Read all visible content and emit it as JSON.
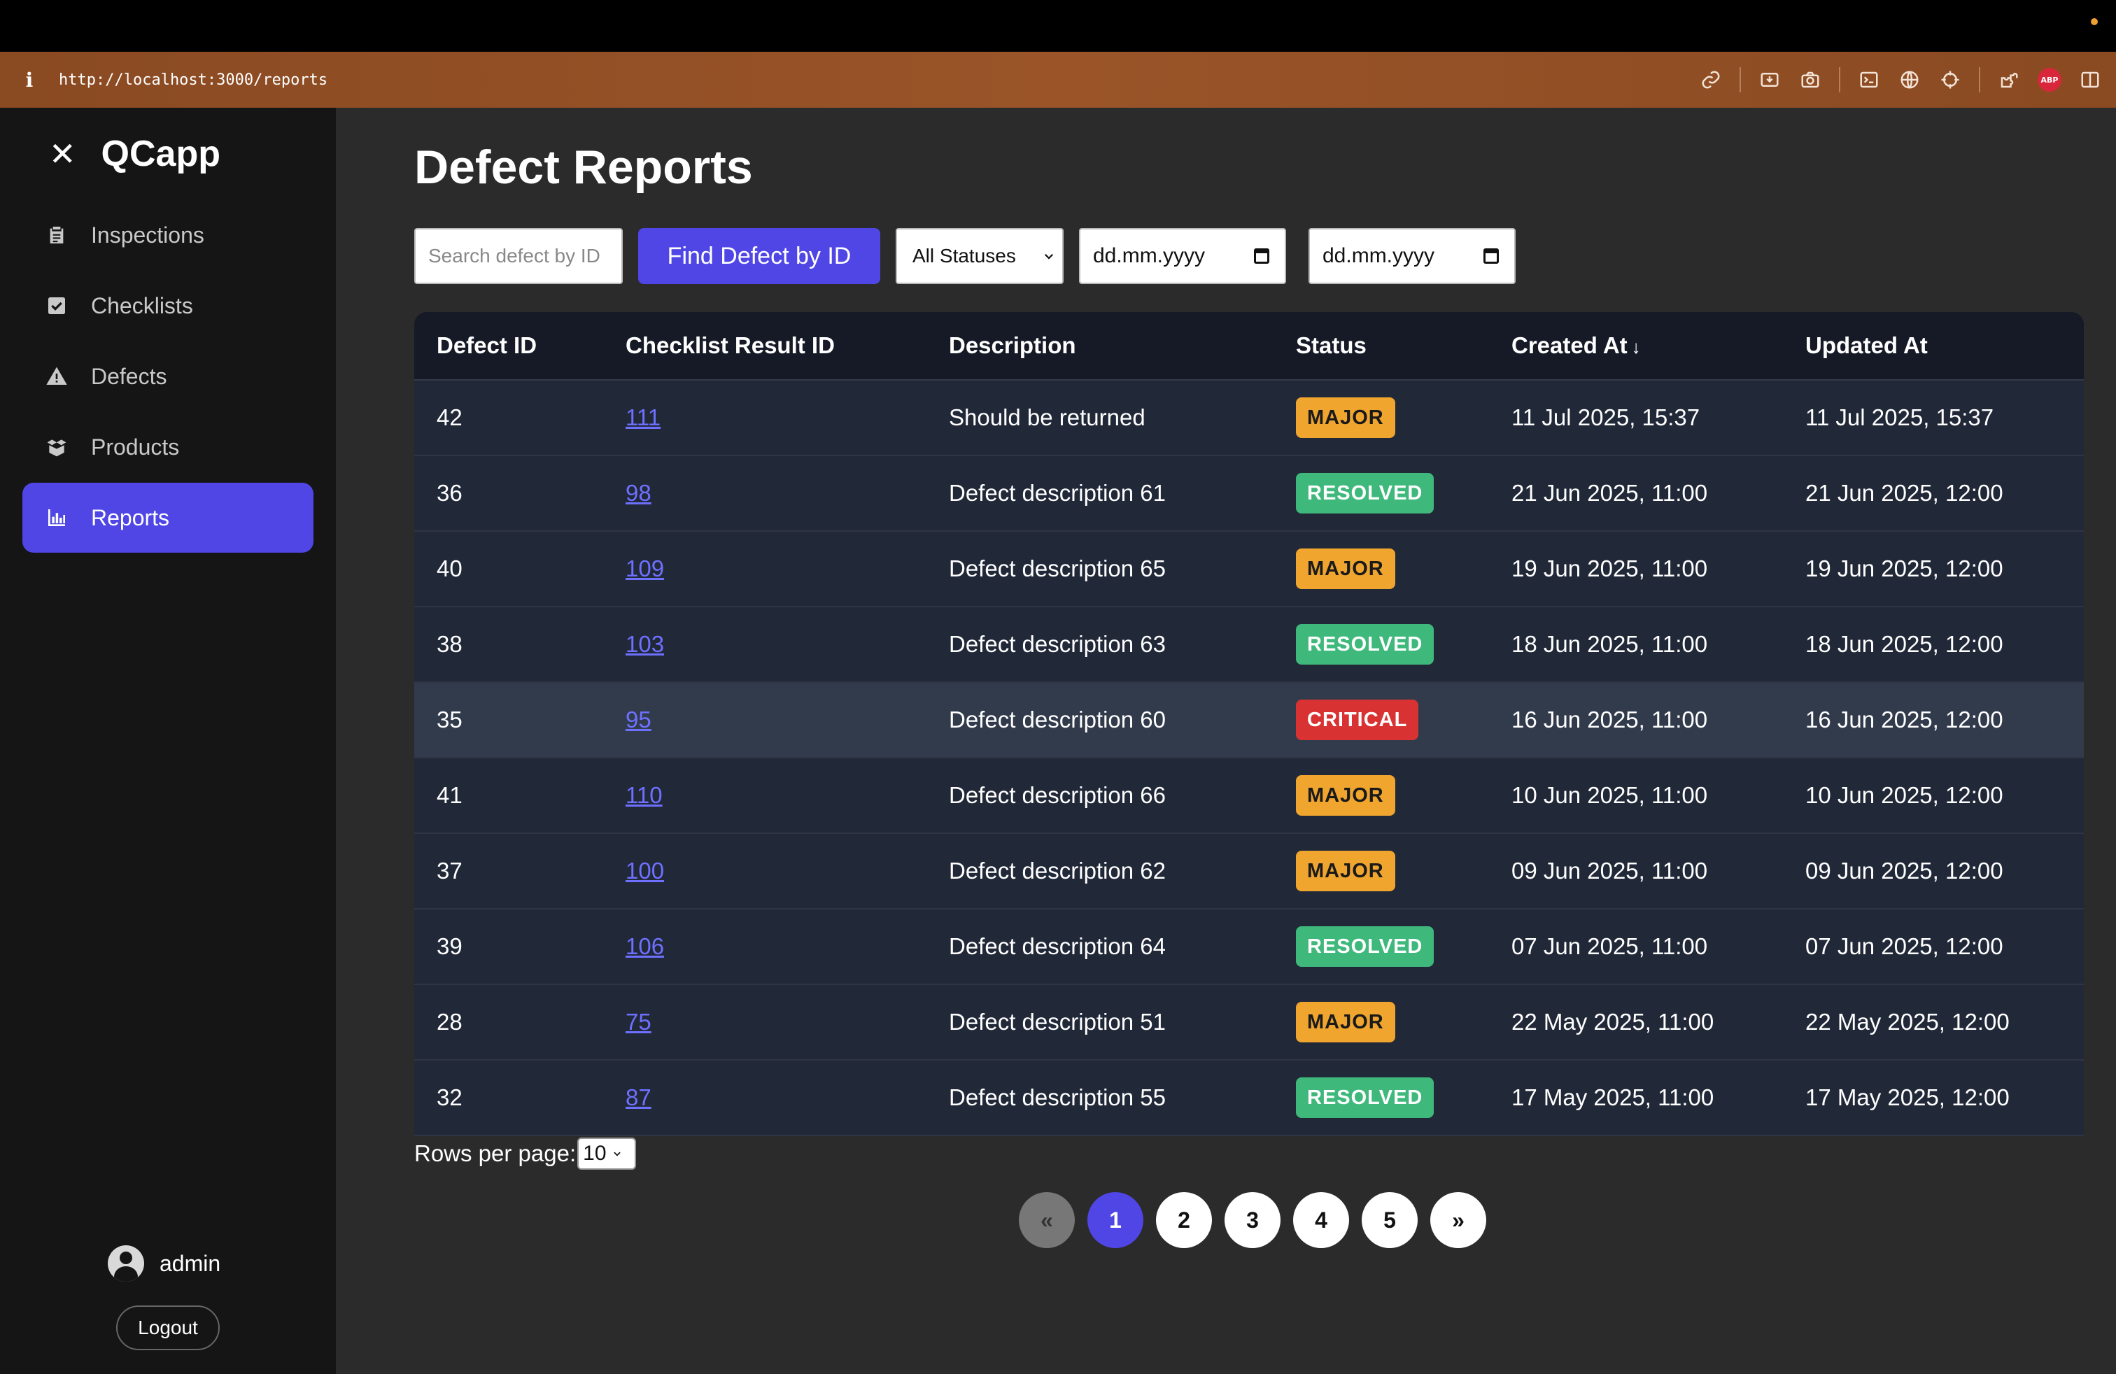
{
  "browser": {
    "url": "http://localhost:3000/reports",
    "info_label": "i",
    "abp_label": "ABP"
  },
  "sidebar": {
    "app_name": "QCapp",
    "close_glyph": "✕",
    "items": [
      {
        "label": "Inspections",
        "icon": "clipboard-icon"
      },
      {
        "label": "Checklists",
        "icon": "checkbox-icon"
      },
      {
        "label": "Defects",
        "icon": "warning-icon"
      },
      {
        "label": "Products",
        "icon": "box-icon"
      },
      {
        "label": "Reports",
        "icon": "bar-chart-icon",
        "active": true
      }
    ],
    "user_name": "admin",
    "logout_label": "Logout"
  },
  "main": {
    "title": "Defect Reports",
    "search_placeholder": "Search defect by ID",
    "find_button": "Find Defect by ID",
    "status_filter": "All Statuses",
    "date_from": "dd.mm.yyyy",
    "date_to": "dd.mm.yyyy",
    "columns": [
      "Defect ID",
      "Checklist Result ID",
      "Description",
      "Status",
      "Created At",
      "Updated At"
    ],
    "sort_indicator": "↓",
    "rows": [
      {
        "id": "42",
        "checklist": "111",
        "desc": "Should be returned",
        "status": "MAJOR",
        "created": "11 Jul 2025, 15:37",
        "updated": "11 Jul 2025, 15:37"
      },
      {
        "id": "36",
        "checklist": "98",
        "desc": "Defect description 61",
        "status": "RESOLVED",
        "created": "21 Jun 2025, 11:00",
        "updated": "21 Jun 2025, 12:00"
      },
      {
        "id": "40",
        "checklist": "109",
        "desc": "Defect description 65",
        "status": "MAJOR",
        "created": "19 Jun 2025, 11:00",
        "updated": "19 Jun 2025, 12:00"
      },
      {
        "id": "38",
        "checklist": "103",
        "desc": "Defect description 63",
        "status": "RESOLVED",
        "created": "18 Jun 2025, 11:00",
        "updated": "18 Jun 2025, 12:00"
      },
      {
        "id": "35",
        "checklist": "95",
        "desc": "Defect description 60",
        "status": "CRITICAL",
        "created": "16 Jun 2025, 11:00",
        "updated": "16 Jun 2025, 12:00",
        "highlighted": true
      },
      {
        "id": "41",
        "checklist": "110",
        "desc": "Defect description 66",
        "status": "MAJOR",
        "created": "10 Jun 2025, 11:00",
        "updated": "10 Jun 2025, 12:00"
      },
      {
        "id": "37",
        "checklist": "100",
        "desc": "Defect description 62",
        "status": "MAJOR",
        "created": "09 Jun 2025, 11:00",
        "updated": "09 Jun 2025, 12:00"
      },
      {
        "id": "39",
        "checklist": "106",
        "desc": "Defect description 64",
        "status": "RESOLVED",
        "created": "07 Jun 2025, 11:00",
        "updated": "07 Jun 2025, 12:00"
      },
      {
        "id": "28",
        "checklist": "75",
        "desc": "Defect description 51",
        "status": "MAJOR",
        "created": "22 May 2025, 11:00",
        "updated": "22 May 2025, 12:00"
      },
      {
        "id": "32",
        "checklist": "87",
        "desc": "Defect description 55",
        "status": "RESOLVED",
        "created": "17 May 2025, 11:00",
        "updated": "17 May 2025, 12:00"
      }
    ],
    "rows_per_page_label": "Rows per page:",
    "rows_per_page_value": "10",
    "pagination": {
      "prev": "«",
      "pages": [
        "1",
        "2",
        "3",
        "4",
        "5"
      ],
      "current": "1",
      "next": "»"
    }
  },
  "colors": {
    "accent": "#4f46e5",
    "major": "#f0a52f",
    "resolved": "#3fb87c",
    "critical": "#d93232"
  }
}
